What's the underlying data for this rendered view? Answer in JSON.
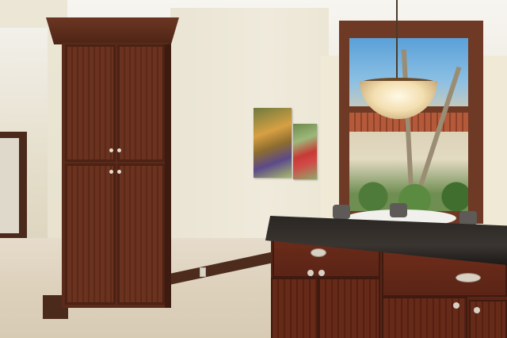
{
  "scene": {
    "description_free": true,
    "colors": {
      "wall": "#efe9d6",
      "cabinet_wood": "#6a321f",
      "countertop": "#2a2623",
      "floor": "#ddd1bc",
      "sky": "#5aa0d8"
    },
    "icons": {
      "pendant": "pendant-light-icon"
    }
  }
}
